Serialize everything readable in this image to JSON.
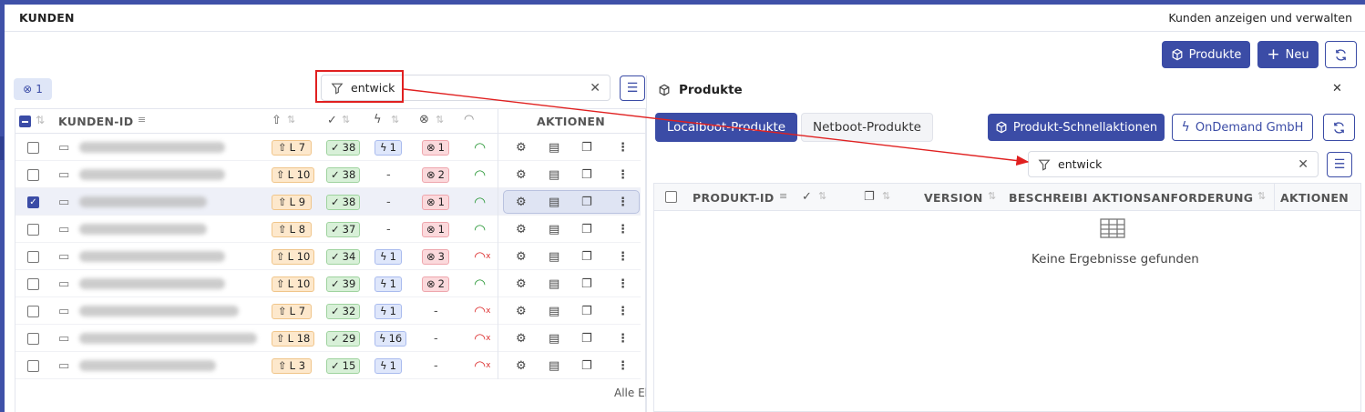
{
  "header": {
    "title": "KUNDEN",
    "subtitle": "Kunden anzeigen und verwalten"
  },
  "toolbar": {
    "products_label": "Produkte",
    "new_label": "Neu"
  },
  "filter_chip": {
    "count": "1"
  },
  "left_search": {
    "value": "entwick"
  },
  "left_table": {
    "columns": {
      "id": "KUNDEN-ID",
      "actions": "AKTIONEN"
    },
    "footer": "Alle El",
    "rows": [
      {
        "level": "L 7",
        "ok": "38",
        "flash": "1",
        "err": "1",
        "wifi": "ok",
        "selected": false
      },
      {
        "level": "L 10",
        "ok": "38",
        "flash": "-",
        "err": "2",
        "wifi": "ok",
        "selected": false
      },
      {
        "level": "L 9",
        "ok": "38",
        "flash": "-",
        "err": "1",
        "wifi": "ok",
        "selected": true
      },
      {
        "level": "L 8",
        "ok": "37",
        "flash": "-",
        "err": "1",
        "wifi": "ok",
        "selected": false
      },
      {
        "level": "L 10",
        "ok": "34",
        "flash": "1",
        "err": "3",
        "wifi": "off",
        "selected": false
      },
      {
        "level": "L 10",
        "ok": "39",
        "flash": "1",
        "err": "2",
        "wifi": "ok",
        "selected": false
      },
      {
        "level": "L 7",
        "ok": "32",
        "flash": "1",
        "err": "-",
        "wifi": "off",
        "selected": false
      },
      {
        "level": "L 18",
        "ok": "29",
        "flash": "16",
        "err": "-",
        "wifi": "off",
        "selected": false
      },
      {
        "level": "L 3",
        "ok": "15",
        "flash": "1",
        "err": "-",
        "wifi": "off",
        "selected": false
      }
    ]
  },
  "right_panel": {
    "title": "Produkte",
    "tabs": [
      "Localboot-Produkte",
      "Netboot-Produkte"
    ],
    "quick_actions_label": "Produkt-Schnellaktionen",
    "depot_label": "OnDemand GmbH",
    "search_value": "entwick",
    "columns": {
      "id": "PRODUKT-ID",
      "version": "VERSION",
      "description": "BESCHREIBI",
      "request": "AKTIONSANFORDERUNG",
      "actions": "AKTIONEN"
    },
    "empty_text": "Keine Ergebnisse gefunden"
  },
  "colors": {
    "primary": "#3b4ca6",
    "annotation": "#e02020"
  }
}
